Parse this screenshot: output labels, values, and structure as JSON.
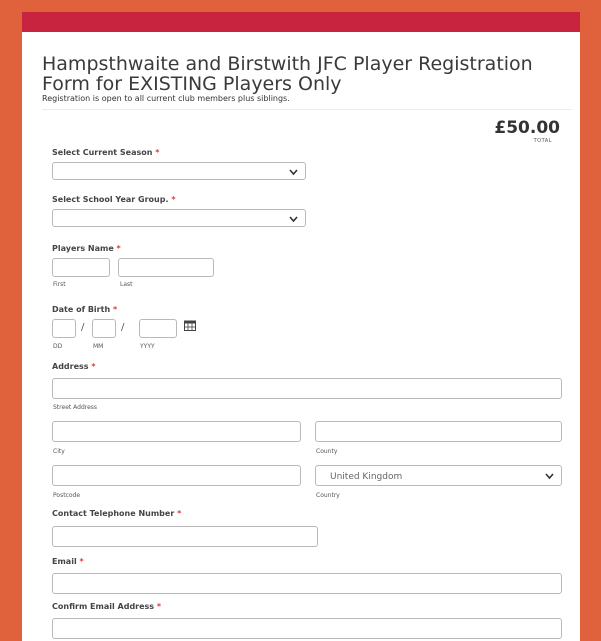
{
  "form": {
    "title": "Hampsthwaite and Birstwith JFC Player Registration Form for EXISTING Players Only",
    "subtitle": "Registration is open to all current club members plus siblings.",
    "price": "£50.00",
    "price_caption": "TOTAL",
    "required_marker": "*"
  },
  "fields": {
    "season": {
      "label": "Select Current Season",
      "value": ""
    },
    "school_year": {
      "label": "Select School Year Group.",
      "value": ""
    },
    "player_name": {
      "label": "Players Name",
      "first_caption": "First",
      "last_caption": "Last"
    },
    "dob": {
      "label": "Date of Birth",
      "dd_caption": "DD",
      "mm_caption": "MM",
      "yyyy_caption": "YYYY",
      "separator": "/"
    },
    "address": {
      "label": "Address",
      "street_caption": "Street Address",
      "city_caption": "City",
      "county_caption": "County",
      "postcode_caption": "Postcode",
      "country_caption": "Country",
      "country_value": "United Kingdom"
    },
    "phone": {
      "label": "Contact Telephone Number"
    },
    "email": {
      "label": "Email"
    },
    "confirm_email": {
      "label": "Confirm Email Address"
    }
  },
  "icons": {
    "calendar": "calendar-icon",
    "dropdown": "chevron-down-icon"
  },
  "colors": {
    "background": "#e0623d",
    "header_bar": "#c9243f",
    "required": "#e2383f"
  }
}
